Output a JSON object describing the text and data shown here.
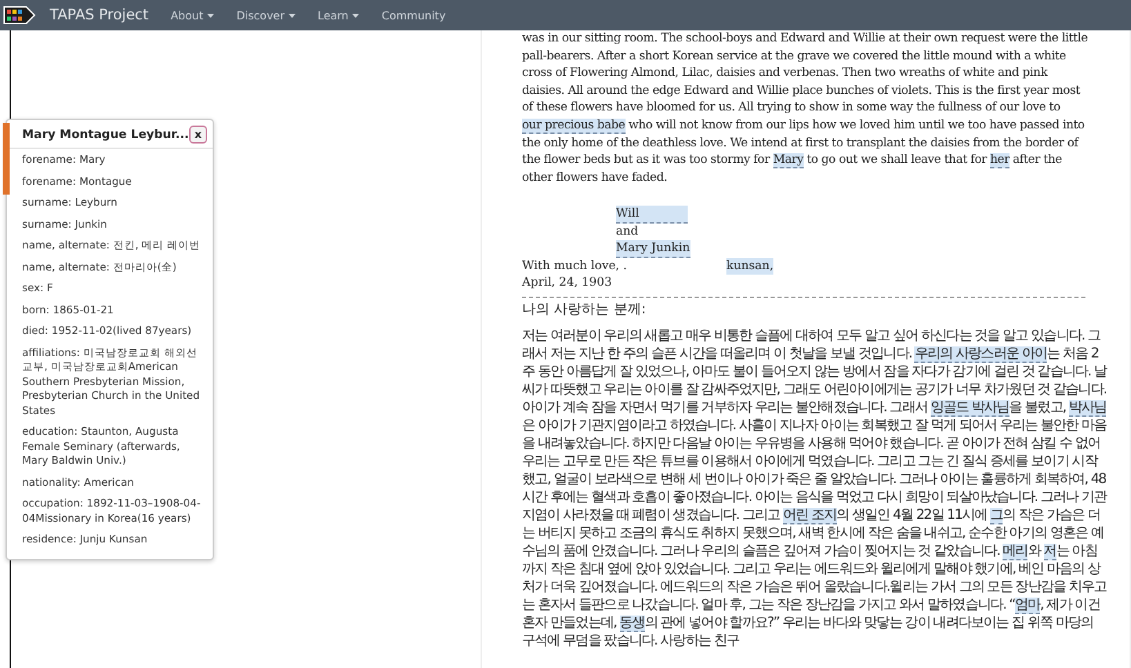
{
  "navbar": {
    "brand": "TAPAS Project",
    "menu": [
      {
        "label": "About",
        "dropdown": true
      },
      {
        "label": "Discover",
        "dropdown": true
      },
      {
        "label": "Learn",
        "dropdown": true
      },
      {
        "label": "Community",
        "dropdown": false
      }
    ]
  },
  "person_popup": {
    "title": "Mary Montague Leybur...",
    "close": "x",
    "fields": [
      "forename: Mary",
      "forename: Montague",
      "surname: Leyburn",
      "surname: Junkin",
      "name, alternate: 전킨, 메리 레이번",
      "name, alternate: 전마리아(全)",
      "sex: F",
      "born: 1865-01-21",
      "died: 1952-11-02(lived 87years)",
      "affiliations: 미국남장로교회 해외선교부, 미국남장로교회American Southern Presbyterian Mission, Presbyterian Church in the United States",
      "education: Staunton, Augusta Female Seminary (afterwards, Mary Baldwin Univ.)",
      "nationality: American",
      "occupation: 1892-11-03–1908-04-04Missionary in Korea(16 years)",
      "residence: Junju Kunsan"
    ]
  },
  "letter": {
    "english_paragraph": [
      {
        "text": "was in our sitting room. The school-boys and Edward and Willie at their own request were the little pall-bearers. After a short Korean service at the grave we covered the little mound with a white cross of Flowering Almond, Lilac, daisies and verbenas. Then two wreaths of white and pink daisies. All around the edge Edward and Willie place bunches of violets. This is the first year most of these flowers have bloomed for us. All trying to show in some way the fullness of our love to ",
        "highlighted": false
      },
      {
        "text": "our precious babe",
        "highlighted": true
      },
      {
        "text": " who will not know from our lips how we loved him until we too have passed into the only home of the deathless love. We intend at first to transplant the daisies from the border of the flower beds but as it was too stormy for ",
        "highlighted": false
      },
      {
        "text": "Mary",
        "highlighted": true
      },
      {
        "text": " to go out we shall leave that for ",
        "highlighted": false
      },
      {
        "text": "her",
        "highlighted": true
      },
      {
        "text": " after the other flowers have faded.",
        "highlighted": false
      }
    ],
    "signers": [
      {
        "text": "Will",
        "highlighted": true
      },
      {
        "text": "and",
        "highlighted": false
      },
      {
        "text": "Mary Junkin",
        "highlighted": true
      }
    ],
    "closing": "With much love, .",
    "place": "kunsan,",
    "date": "April, 24, 1903",
    "korean_salutation": "나의 사랑하는 분께:",
    "korean_paragraph": [
      {
        "text": "저는 여러분이 우리의 새롭고 매우 비통한 슬픔에 대하여 모두 알고 싶어 하신다는 것을 알고 있습니다. 그래서 저는 지난 한 주의 슬픈 시간을 떠올리며 이 첫날을 보낼 것입니다. ",
        "highlighted": false
      },
      {
        "text": "우리의 사랑스러운 아이",
        "highlighted": true
      },
      {
        "text": "는 처음 2주 동안 아름답게 잘 있었으나, 아마도 불이 들어오지 않는 방에서 잠을 자다가 감기에 걸린 것 같습니다. 날씨가 따뜻했고 우리는 아이를 잘 감싸주었지만, 그래도 어린아이에게는 공기가 너무 차가웠던 것 같습니다. 아이가 계속 잠을 자면서 먹기를 거부하자 우리는 불안해졌습니다. 그래서 ",
        "highlighted": false
      },
      {
        "text": "잉골드 박사님",
        "highlighted": true
      },
      {
        "text": "을 불렀고, ",
        "highlighted": false
      },
      {
        "text": "박사님",
        "highlighted": true
      },
      {
        "text": "은 아이가 기관지염이라고 하였습니다. 사흘이 지나자 아이는 회복했고 잘 먹게 되어서 우리는 불안한 마음을 내려놓았습니다. 하지만 다음날 아이는 우유병을 사용해 먹어야 했습니다. 곧 아이가 전혀 삼킬 수 없어 우리는 고무로 만든 작은 튜브를 이용해서 아이에게 먹였습니다. 그리고 그는 긴 질식 증세를 보이기 시작했고, 얼굴이 보라색으로 변해 세 번이나 아이가 죽은 줄 알았습니다. 그러나 아이는 훌륭하게 회복하여, 48시간 후에는 혈색과 호흡이 좋아졌습니다. 아이는 음식을 먹었고 다시 희망이 되살아났습니다. 그러나 기관지염이 사라졌을 때 폐렴이 생겼습니다. 그리고 ",
        "highlighted": false
      },
      {
        "text": "어린 조지",
        "highlighted": true
      },
      {
        "text": "의 생일인 4월 22일 11시에 ",
        "highlighted": false
      },
      {
        "text": "그",
        "highlighted": true
      },
      {
        "text": "의 작은 가슴은 더는 버티지 못하고 조금의 휴식도 취하지 못했으며, 새벽 한시에 작은 숨을 내쉬고, 순수한 아기의 영혼은 예수님의 품에 안겼습니다. 그러나 우리의 슬픔은 깊어져 가슴이 찢어지는 것 같았습니다. ",
        "highlighted": false
      },
      {
        "text": "메리",
        "highlighted": true
      },
      {
        "text": "와 ",
        "highlighted": false
      },
      {
        "text": "저",
        "highlighted": true
      },
      {
        "text": "는 아침까지 작은 침대 옆에 앉아 있었습니다. 그리고 우리는 에드워드와 윌리에게 말해야 했기에, 베인 마음의 상처가 더욱 깊어졌습니다. 에드워드의 작은 가슴은 뛰어 올랐습니다.윌리는 가서 그의 모든 장난감을 치우고는 혼자서 들판으로 나갔습니다. 얼마 후, 그는 작은 장난감을 가지고 와서 말하였습니다. “",
        "highlighted": false
      },
      {
        "text": "엄마",
        "highlighted": true
      },
      {
        "text": ", 제가 이건 혼자 만들었는데, ",
        "highlighted": false
      },
      {
        "text": "동생",
        "highlighted": true
      },
      {
        "text": "의 관에 넣어야 할까요?” 우리는 바다와 맞닿는 강이 내려다보이는 집 위쪽 마당의 구석에 무덤을 팠습니다. 사랑하는 친구",
        "highlighted": false
      }
    ]
  }
}
